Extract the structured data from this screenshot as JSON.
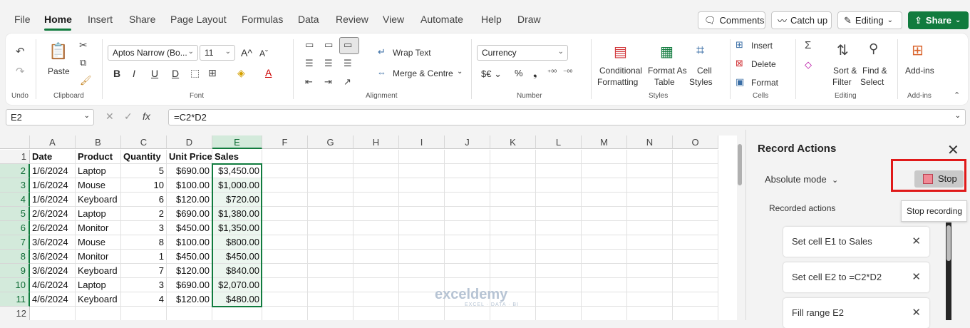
{
  "menu": {
    "items": [
      "File",
      "Home",
      "Insert",
      "Share",
      "Page Layout",
      "Formulas",
      "Data",
      "Review",
      "View",
      "Automate",
      "Help",
      "Draw"
    ],
    "active": "Home"
  },
  "top_buttons": {
    "comments": "Comments",
    "catch_up": "Catch up",
    "editing": "Editing",
    "share": "Share"
  },
  "ribbon": {
    "undo_group": "Undo",
    "clipboard": {
      "paste": "Paste",
      "label": "Clipboard"
    },
    "font": {
      "name": "Aptos Narrow (Bo...",
      "size": "11",
      "label": "Font",
      "bold": "B",
      "italic": "I",
      "underline": "U",
      "strike": "D"
    },
    "alignment": {
      "wrap": "Wrap Text",
      "merge": "Merge & Centre",
      "label": "Alignment"
    },
    "number": {
      "format": "Currency",
      "label": "Number"
    },
    "styles": {
      "conditional_1": "Conditional",
      "conditional_2": "Formatting",
      "format_table_1": "Format As",
      "format_table_2": "Table",
      "cell_styles_1": "Cell",
      "cell_styles_2": "Styles",
      "label": "Styles"
    },
    "cells": {
      "insert": "Insert",
      "delete": "Delete",
      "format": "Format",
      "label": "Cells"
    },
    "editing": {
      "sort_1": "Sort &",
      "sort_2": "Filter",
      "find_1": "Find &",
      "find_2": "Select",
      "label": "Editing"
    },
    "addins": {
      "addins": "Add-ins",
      "label": "Add-ins"
    }
  },
  "formula_bar": {
    "name_box": "E2",
    "formula": "=C2*D2",
    "fx": "fx"
  },
  "sheet": {
    "columns": [
      "A",
      "B",
      "C",
      "D",
      "E",
      "F",
      "G",
      "H",
      "I",
      "J",
      "K",
      "L",
      "M",
      "N",
      "O"
    ],
    "row_numbers": [
      "1",
      "2",
      "3",
      "4",
      "5",
      "6",
      "7",
      "8",
      "9",
      "10",
      "11",
      "12"
    ],
    "headers": [
      "Date",
      "Product",
      "Quantity",
      "Unit Price",
      "Sales"
    ],
    "rows": [
      [
        "1/6/2024",
        "Laptop",
        "5",
        "$690.00",
        "$3,450.00"
      ],
      [
        "1/6/2024",
        "Mouse",
        "10",
        "$100.00",
        "$1,000.00"
      ],
      [
        "1/6/2024",
        "Keyboard",
        "6",
        "$120.00",
        "$720.00"
      ],
      [
        "2/6/2024",
        "Laptop",
        "2",
        "$690.00",
        "$1,380.00"
      ],
      [
        "2/6/2024",
        "Monitor",
        "3",
        "$450.00",
        "$1,350.00"
      ],
      [
        "3/6/2024",
        "Mouse",
        "8",
        "$100.00",
        "$800.00"
      ],
      [
        "3/6/2024",
        "Monitor",
        "1",
        "$450.00",
        "$450.00"
      ],
      [
        "3/6/2024",
        "Keyboard",
        "7",
        "$120.00",
        "$840.00"
      ],
      [
        "4/6/2024",
        "Laptop",
        "3",
        "$690.00",
        "$2,070.00"
      ],
      [
        "4/6/2024",
        "Keyboard",
        "4",
        "$120.00",
        "$480.00"
      ]
    ]
  },
  "watermark": {
    "name": "exceldemy",
    "tagline": "EXCEL · DATA · BI"
  },
  "panel": {
    "title": "Record Actions",
    "mode": "Absolute mode",
    "stop": "Stop",
    "tooltip": "Stop recording",
    "recorded_label": "Recorded actions",
    "actions": [
      "Set cell E1 to Sales",
      "Set cell E2 to =C2*D2",
      "Fill range E2"
    ]
  }
}
